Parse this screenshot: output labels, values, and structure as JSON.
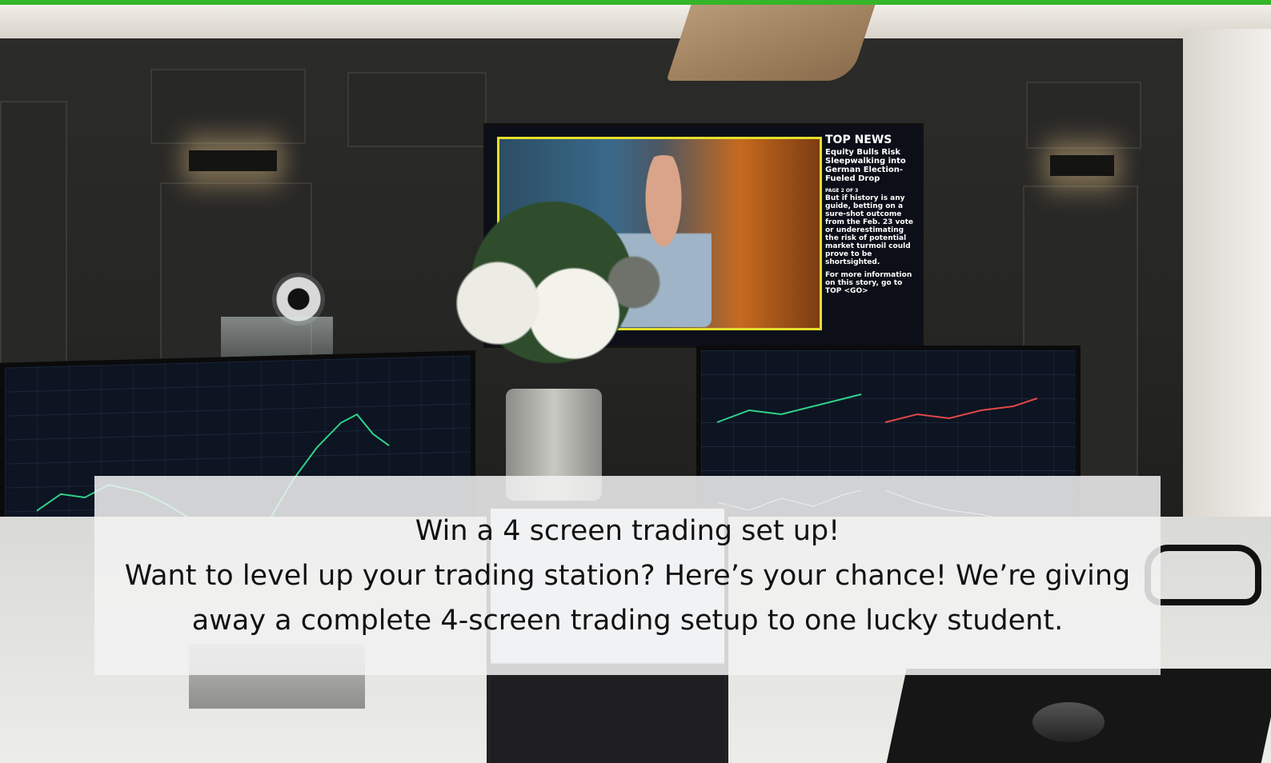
{
  "tv": {
    "headline": "TOP NEWS",
    "story": "Equity Bulls Risk Sleepwalking into German Election-Fueled Drop",
    "page": "PAGE 2 OF 3",
    "detail": "But if history is any guide, betting on a sure-shot outcome from the Feb. 23 vote or underestimating the risk of potential market turmoil could prove to be shortsighted.",
    "more": "For more information on this story, go to TOP <GO>"
  },
  "overlay": {
    "title": "Win a 4 screen trading set up!",
    "body": "Want to level up your trading station? Here’s your chance! We’re giving away a complete 4-screen trading setup to one lucky student."
  },
  "colors": {
    "accent_bar": "#35b52a",
    "tv_border": "#e5df2b",
    "chart_bg": "#0d1422"
  }
}
